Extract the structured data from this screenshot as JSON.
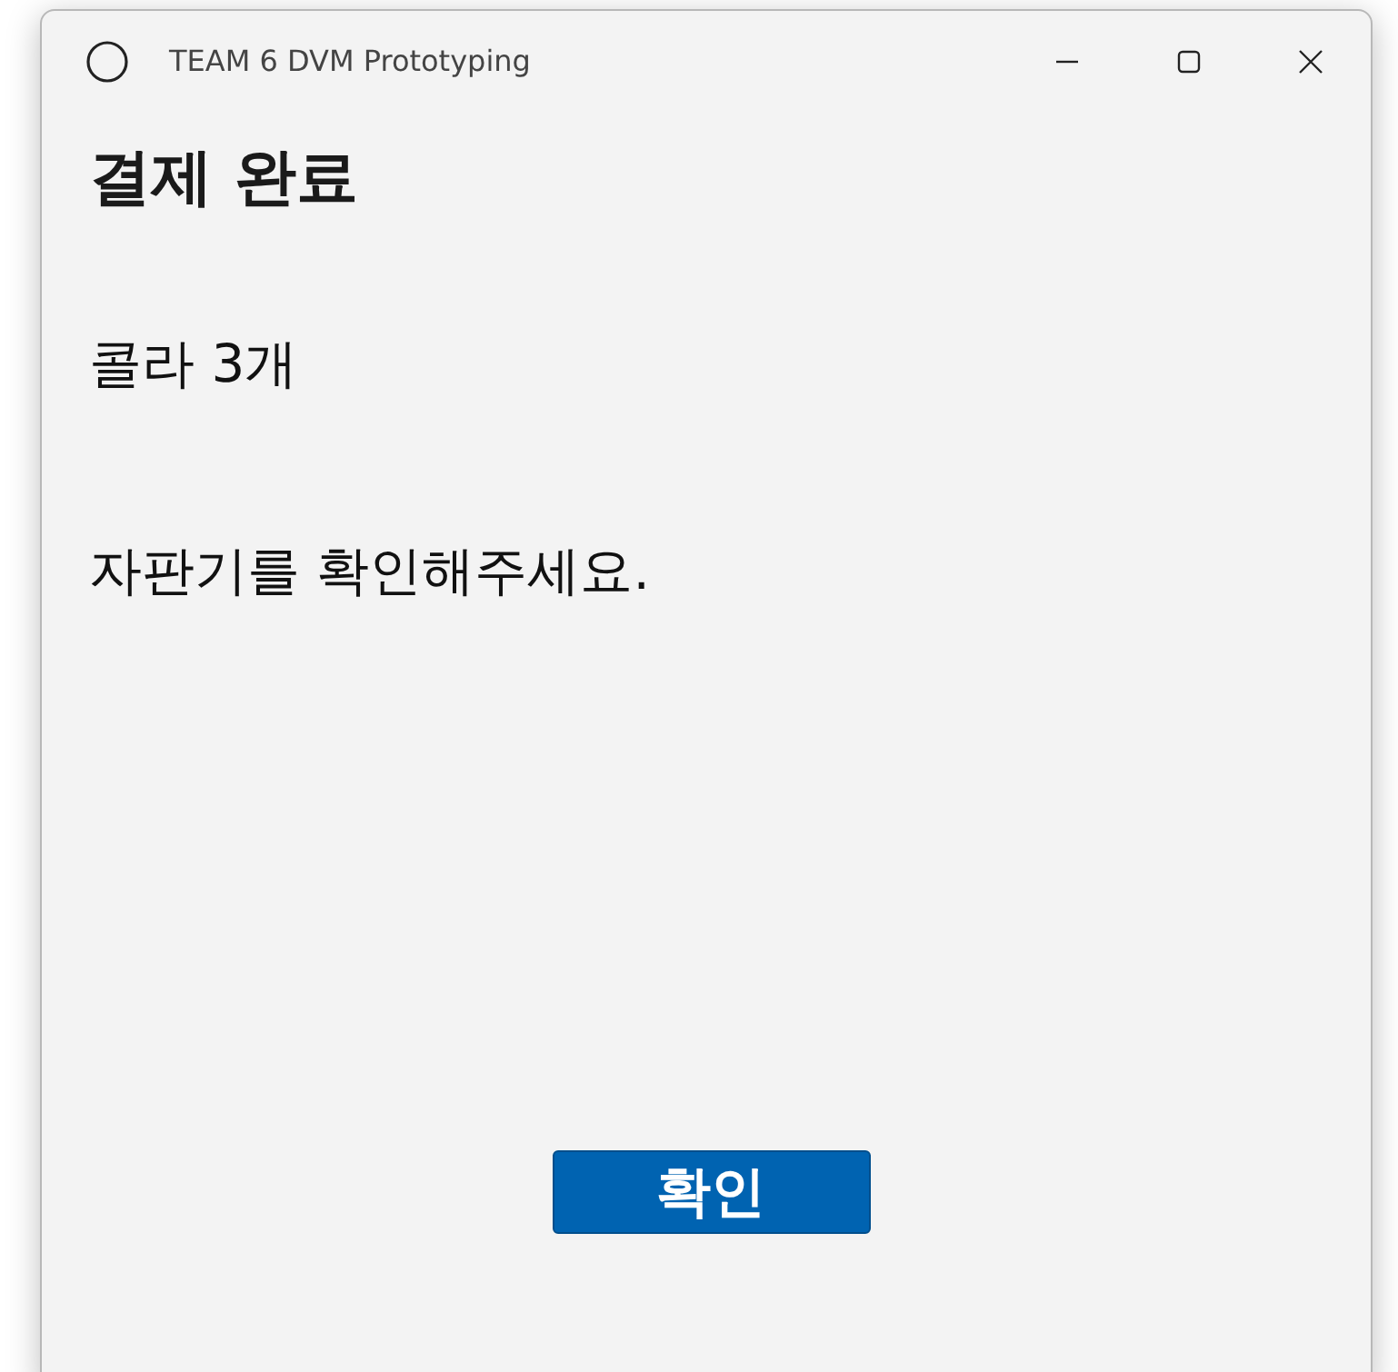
{
  "window": {
    "title": "TEAM 6 DVM Prototyping"
  },
  "heading": "결제 완료",
  "order": "콜라 3개",
  "message": "자판기를 확인해주세요.",
  "buttons": [
    {
      "label": "확인",
      "kind": "primary"
    }
  ]
}
